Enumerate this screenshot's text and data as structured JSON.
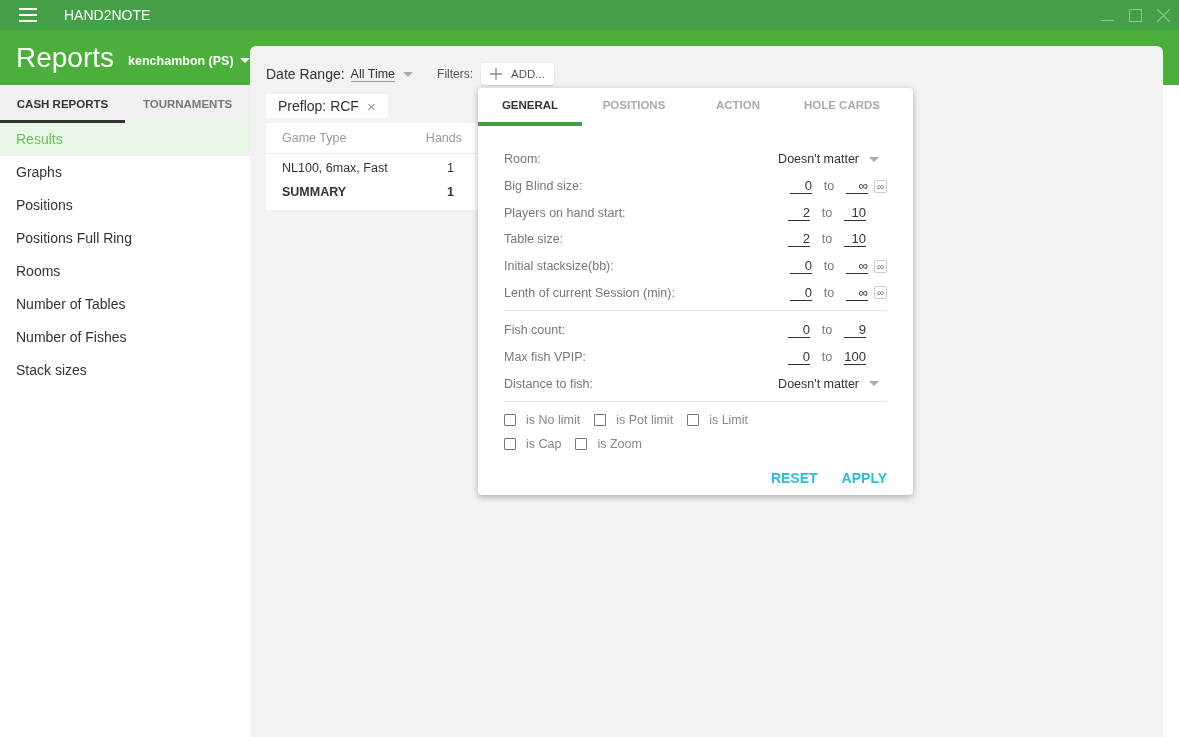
{
  "window": {
    "title": "HAND2NOTE"
  },
  "header": {
    "title": "Reports",
    "account": "kenchambon (PS)"
  },
  "sidebar": {
    "tabs": [
      {
        "label": "CASH REPORTS",
        "selected": true
      },
      {
        "label": "TOURNAMENTS",
        "selected": false
      }
    ],
    "items": [
      {
        "label": "Results",
        "selected": true
      },
      {
        "label": "Graphs",
        "selected": false
      },
      {
        "label": "Positions",
        "selected": false
      },
      {
        "label": "Positions Full Ring",
        "selected": false
      },
      {
        "label": "Rooms",
        "selected": false
      },
      {
        "label": "Number of Tables",
        "selected": false
      },
      {
        "label": "Number of Fishes",
        "selected": false
      },
      {
        "label": "Stack sizes",
        "selected": false
      }
    ]
  },
  "toolbar": {
    "date_range_label": "Date Range:",
    "date_range_value": "All Time",
    "filters_label": "Filters:",
    "add_button": "ADD..."
  },
  "active_filters": [
    {
      "label": "Preflop: RCF",
      "remove": "×"
    }
  ],
  "table": {
    "columns": [
      "Game Type",
      "Hands"
    ],
    "rows": [
      {
        "cells": [
          "NL100, 6max, Fast",
          "1"
        ],
        "bold": false
      },
      {
        "cells": [
          "SUMMARY",
          "1"
        ],
        "bold": true
      }
    ]
  },
  "filter_popup": {
    "tabs": [
      {
        "label": "GENERAL",
        "selected": true
      },
      {
        "label": "POSITIONS",
        "selected": false
      },
      {
        "label": "ACTION",
        "selected": false
      },
      {
        "label": "HOLE CARDS",
        "selected": false
      }
    ],
    "groups": [
      [
        {
          "kind": "select",
          "label": "Room:",
          "value": "Doesn't matter"
        },
        {
          "kind": "range",
          "label": "Big Blind size:",
          "from": "0",
          "to_word": "to",
          "to": "∞",
          "infinity_button": "∞"
        },
        {
          "kind": "range",
          "label": "Players on hand start:",
          "from": "2",
          "to_word": "to",
          "to": "10"
        },
        {
          "kind": "range",
          "label": "Table size:",
          "from": "2",
          "to_word": "to",
          "to": "10"
        },
        {
          "kind": "range",
          "label": "Initial stacksize(bb):",
          "from": "0",
          "to_word": "to",
          "to": "∞",
          "infinity_button": "∞"
        },
        {
          "kind": "range",
          "label": "Lenth of current Session (min):",
          "from": "0",
          "to_word": "to",
          "to": "∞",
          "infinity_button": "∞"
        }
      ],
      [
        {
          "kind": "range",
          "label": "Fish count:",
          "from": "0",
          "to_word": "to",
          "to": "9"
        },
        {
          "kind": "range",
          "label": "Max fish VPIP:",
          "from": "0",
          "to_word": "to",
          "to": "100"
        },
        {
          "kind": "select",
          "label": "Distance to fish:",
          "value": "Doesn't matter"
        }
      ]
    ],
    "checkbox_rows": [
      [
        {
          "label": "is No limit",
          "checked": false
        },
        {
          "label": "is Pot limit",
          "checked": false
        },
        {
          "label": "is Limit",
          "checked": false
        }
      ],
      [
        {
          "label": "is Cap",
          "checked": false
        },
        {
          "label": "is Zoom",
          "checked": false
        }
      ]
    ],
    "buttons": [
      "RESET",
      "APPLY"
    ]
  }
}
